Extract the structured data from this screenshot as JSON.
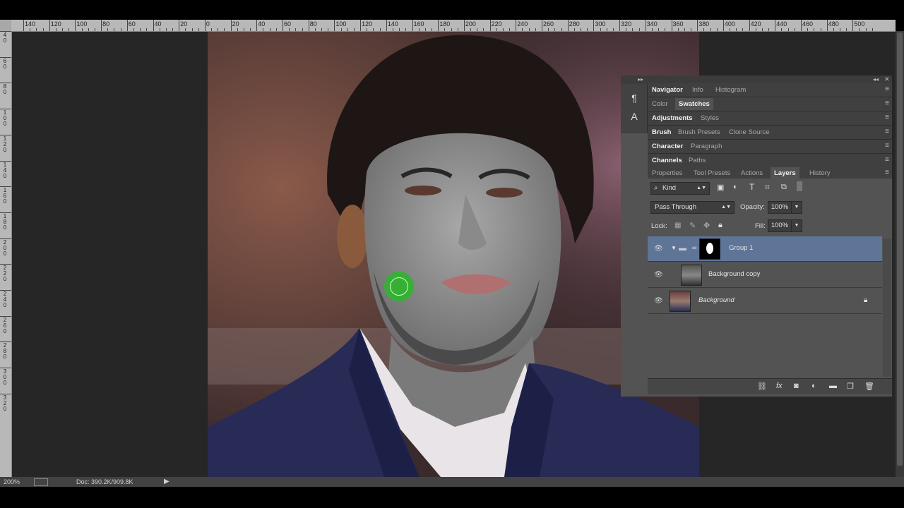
{
  "ruler": {
    "h_labels": [
      "140",
      "120",
      "100",
      "80",
      "60",
      "40",
      "20",
      "0",
      "20",
      "40",
      "60",
      "80",
      "100",
      "120",
      "140",
      "160",
      "180",
      "200",
      "220",
      "240",
      "260",
      "280",
      "300",
      "320",
      "340",
      "360",
      "380",
      "400",
      "420",
      "440",
      "460",
      "480",
      "500"
    ],
    "v_labels": [
      "4\n0",
      "6\n0",
      "8\n0",
      "1\n0\n0",
      "1\n2\n0",
      "1\n4\n0",
      "1\n6\n0",
      "1\n8\n0",
      "2\n0\n0",
      "2\n2\n0",
      "2\n4\n0",
      "2\n6\n0",
      "2\n8\n0",
      "3\n0\n0",
      "3\n2\n0"
    ]
  },
  "status": {
    "zoom": "200%",
    "doc": "Doc: 390.2K/909.8K"
  },
  "panels": {
    "row1": [
      "Navigator",
      "Info",
      "Histogram"
    ],
    "row2": [
      "Color",
      "Swatches"
    ],
    "row3": [
      "Adjustments",
      "Styles"
    ],
    "row4": [
      "Brush",
      "Brush Presets",
      "Clone Source"
    ],
    "row5": [
      "Character",
      "Paragraph"
    ],
    "row6": [
      "Channels",
      "Paths"
    ],
    "row7": [
      "Properties",
      "Tool Presets",
      "Actions",
      "Layers",
      "History"
    ]
  },
  "layers": {
    "filter_kind": "Kind",
    "blend_mode": "Pass Through",
    "opacity_label": "Opacity:",
    "opacity_value": "100%",
    "lock_label": "Lock:",
    "fill_label": "Fill:",
    "fill_value": "100%",
    "items": [
      {
        "name": "Group 1",
        "selected": true
      },
      {
        "name": "Background copy",
        "selected": false
      },
      {
        "name": "Background",
        "selected": false
      }
    ]
  },
  "colors": {
    "selection": "#5e7597",
    "brush_cursor": "#2fb52f"
  }
}
